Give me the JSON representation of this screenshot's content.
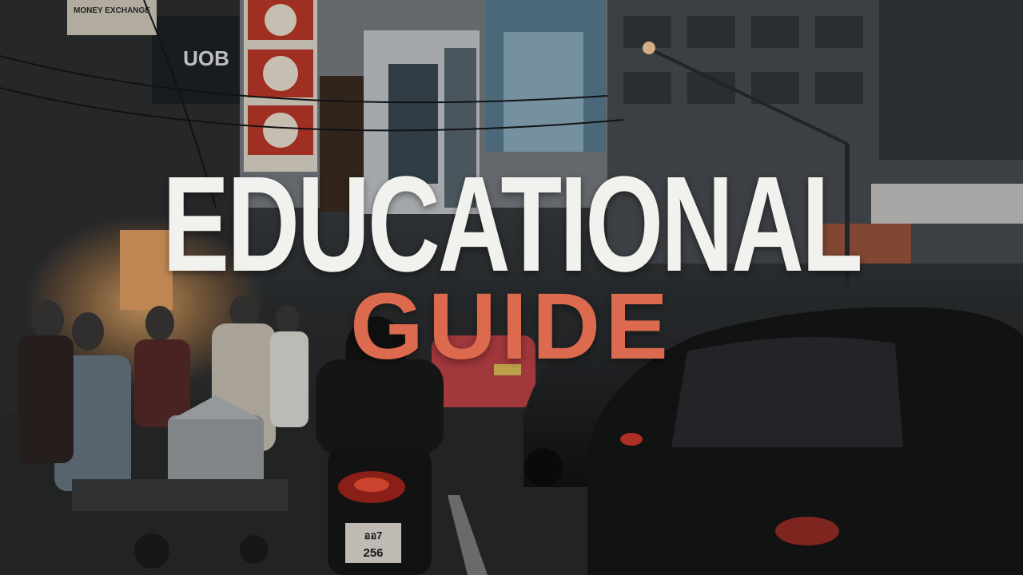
{
  "title": {
    "headline": "EDUCATIONAL",
    "subline": "GUIDE"
  },
  "colors": {
    "headline": "#f1f1ee",
    "subline": "#dc6a4e",
    "sky": "#5d6166",
    "street": "#2a2c2d"
  },
  "signs": {
    "money_exchange": "MONEY EXCHANGE",
    "bank": "UOB",
    "plate_top": "ออ7",
    "plate_bottom": "256"
  }
}
